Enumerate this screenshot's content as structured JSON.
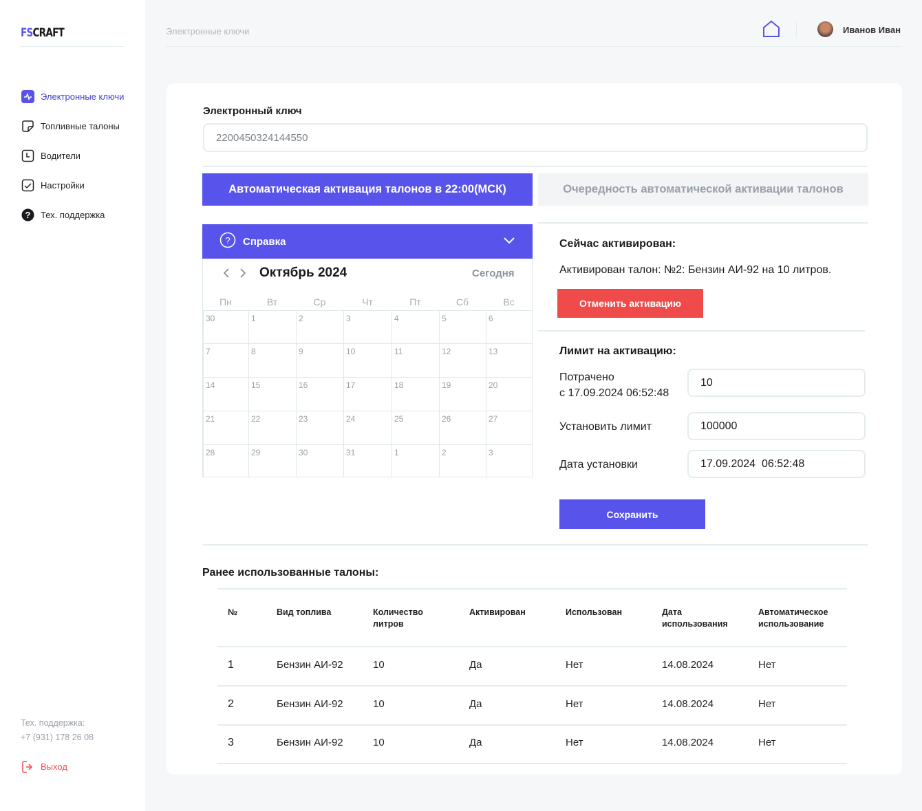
{
  "sidebar": {
    "logo": {
      "part1": "FS",
      "part2": "CRAFT"
    },
    "items": [
      {
        "label": "Электронные ключи",
        "icon": "activity-icon",
        "active": true
      },
      {
        "label": "Топливные талоны",
        "icon": "sticker-icon"
      },
      {
        "label": "Водители",
        "icon": "clock-icon"
      },
      {
        "label": "Настройки",
        "icon": "checkbox-icon"
      },
      {
        "label": "Тех. поддержка",
        "icon": "help-icon"
      }
    ],
    "support_label": "Тех. поддержка:",
    "support_phone": "+7 (931) 178 26 08",
    "logout": "Выход"
  },
  "header": {
    "breadcrumb": "Электронные ключи",
    "user_name": "Иванов Иван"
  },
  "key": {
    "label": "Электронный ключ",
    "value": "2200450324144550"
  },
  "tabs": [
    {
      "label": "Автоматическая активация талонов в 22:00(МСК)",
      "active": true
    },
    {
      "label": "Очередность автоматической активации талонов",
      "active": false
    }
  ],
  "help": {
    "label": "Справка"
  },
  "calendar": {
    "month": "Октябрь 2024",
    "today": "Сегодня",
    "weekdays": [
      "Пн",
      "Вт",
      "Ср",
      "Чт",
      "Пт",
      "Сб",
      "Вс"
    ],
    "weeks": [
      [
        "30",
        "1",
        "2",
        "3",
        "4",
        "5",
        "6"
      ],
      [
        "7",
        "8",
        "9",
        "10",
        "11",
        "12",
        "13"
      ],
      [
        "14",
        "15",
        "16",
        "17",
        "18",
        "19",
        "20"
      ],
      [
        "21",
        "22",
        "23",
        "24",
        "25",
        "26",
        "27"
      ],
      [
        "28",
        "29",
        "30",
        "31",
        "1",
        "2",
        "3"
      ]
    ]
  },
  "active": {
    "title": "Сейчас активирован:",
    "text": "Активирован талон: №2: Бензин АИ-92 на 10 литров.",
    "cancel": "Отменить активацию"
  },
  "limit": {
    "title": "Лимит на активацию:",
    "spent_label_1": "Потрачено",
    "spent_label_2": "с 17.09.2024 06:52:48",
    "spent_value": "10",
    "set_label": "Установить лимит",
    "set_value": "100000",
    "date_label": "Дата установки",
    "date_value": "17.09.2024  06:52:48",
    "save": "Сохранить"
  },
  "history": {
    "title": "Ранее использованные талоны:",
    "headers": [
      [
        "№",
        ""
      ],
      [
        "Вид топлива",
        ""
      ],
      [
        "Количество",
        "литров"
      ],
      [
        "Активирован",
        ""
      ],
      [
        "Использован",
        ""
      ],
      [
        "Дата",
        "использования"
      ],
      [
        "Автоматическое",
        "использование"
      ]
    ],
    "rows": [
      [
        "1",
        "Бензин АИ-92",
        "10",
        "Да",
        "Нет",
        "14.08.2024",
        "Нет"
      ],
      [
        "2",
        "Бензин АИ-92",
        "10",
        "Да",
        "Нет",
        "14.08.2024",
        "Нет"
      ],
      [
        "3",
        "Бензин АИ-92",
        "10",
        "Да",
        "Нет",
        "14.08.2024",
        "Нет"
      ]
    ]
  },
  "colors": {
    "accent": "#5753eb",
    "danger": "#ef4b4b",
    "border": "#e4ecee"
  }
}
